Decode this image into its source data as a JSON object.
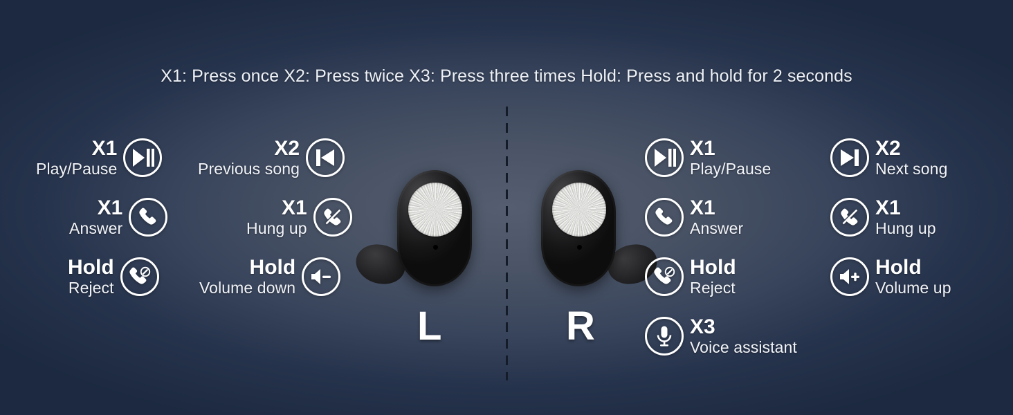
{
  "caption": "X1: Press once X2: Press twice X3: Press three times Hold: Press and hold for 2 seconds",
  "earbuds": {
    "left_label": "L",
    "right_label": "R"
  },
  "colors": {
    "background_outer": "#1c2940",
    "background_inner": "#545e70",
    "text": "#ffffff",
    "divider": "#141c29"
  },
  "left_column_1": [
    {
      "press": "X1",
      "action": "Play/Pause",
      "icon": "play-pause-icon"
    },
    {
      "press": "X1",
      "action": "Answer",
      "icon": "phone-answer-icon"
    },
    {
      "press": "Hold",
      "action": "Reject",
      "icon": "phone-reject-icon"
    }
  ],
  "left_column_2": [
    {
      "press": "X2",
      "action": "Previous song",
      "icon": "previous-track-icon"
    },
    {
      "press": "X1",
      "action": "Hung up",
      "icon": "phone-hangup-icon"
    },
    {
      "press": "Hold",
      "action": "Volume down",
      "icon": "volume-down-icon"
    }
  ],
  "right_column_1": [
    {
      "press": "X1",
      "action": "Play/Pause",
      "icon": "play-pause-icon"
    },
    {
      "press": "X1",
      "action": "Answer",
      "icon": "phone-answer-icon"
    },
    {
      "press": "Hold",
      "action": "Reject",
      "icon": "phone-reject-icon"
    },
    {
      "press": "X3",
      "action": "Voice assistant",
      "icon": "microphone-icon"
    }
  ],
  "right_column_2": [
    {
      "press": "X2",
      "action": "Next song",
      "icon": "next-track-icon"
    },
    {
      "press": "X1",
      "action": "Hung up",
      "icon": "phone-hangup-icon"
    },
    {
      "press": "Hold",
      "action": "Volume up",
      "icon": "volume-up-icon"
    }
  ]
}
